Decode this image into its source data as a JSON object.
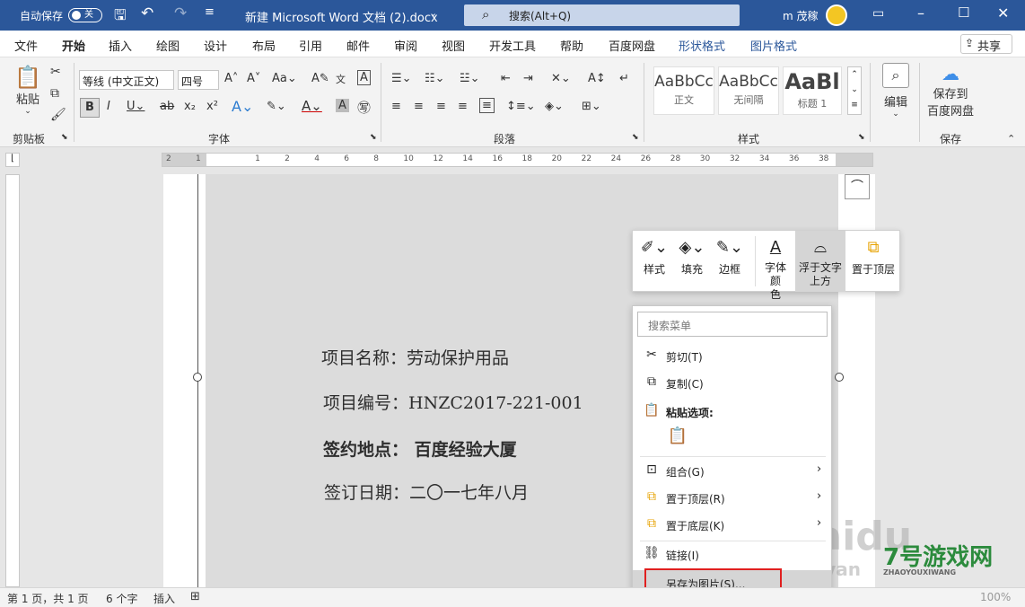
{
  "titlebar": {
    "autosave_label": "自动保存",
    "autosave_state": "关",
    "doc_title": "新建 Microsoft Word 文档 (2).docx",
    "search_placeholder": "搜索(Alt+Q)",
    "user_name": "m 茂稼"
  },
  "tabs": [
    "文件",
    "开始",
    "插入",
    "绘图",
    "设计",
    "布局",
    "引用",
    "邮件",
    "审阅",
    "视图",
    "开发工具",
    "帮助",
    "百度网盘",
    "形状格式",
    "图片格式"
  ],
  "active_tab": "开始",
  "share_label": "共享",
  "ribbon": {
    "clipboard": {
      "paste": "粘贴",
      "group": "剪贴板"
    },
    "font": {
      "name": "等线 (中文正文)",
      "size": "四号",
      "group": "字体"
    },
    "paragraph": {
      "group": "段落"
    },
    "styles": {
      "items": [
        {
          "preview": "AaBbCc",
          "name": "正文"
        },
        {
          "preview": "AaBbCc",
          "name": "无间隔"
        },
        {
          "preview": "AaBl",
          "name": "标题 1"
        }
      ],
      "group": "样式"
    },
    "editing": {
      "label": "编辑"
    },
    "save": {
      "label_line1": "保存到",
      "label_line2": "百度网盘",
      "group": "保存"
    }
  },
  "ruler_ticks": [
    "2",
    "1",
    "",
    "1",
    "2",
    "4",
    "6",
    "8",
    "10",
    "12",
    "14",
    "16",
    "18",
    "20",
    "22",
    "24",
    "26",
    "28",
    "30",
    "32",
    "34",
    "36",
    "38"
  ],
  "document": {
    "lines": [
      "项目名称：劳动保护用品",
      "项目编号：HNZC2017-221-001",
      "签约地点： 百度经验大厦",
      "签订日期：二〇一七年八月"
    ]
  },
  "mini_toolbar": [
    {
      "label": "样式",
      "icon": "style-icon"
    },
    {
      "label": "填充",
      "icon": "fill-icon"
    },
    {
      "label": "边框",
      "icon": "border-icon"
    },
    {
      "label": "字体颜",
      "label2": "色",
      "icon": "font-color-icon"
    },
    {
      "label": "浮于文字",
      "label2": "上方",
      "icon": "float-above-icon"
    },
    {
      "label": "置于顶层",
      "icon": "bring-front-icon"
    }
  ],
  "context_menu": {
    "search_placeholder": "搜索菜单",
    "items": [
      {
        "label": "剪切(T)",
        "icon": "cut-icon"
      },
      {
        "label": "复制(C)",
        "icon": "copy-icon"
      },
      {
        "label": "粘贴选项:",
        "icon": "paste-icon"
      },
      {
        "label": "组合(G)",
        "icon": "group-icon"
      },
      {
        "label": "置于顶层(R)",
        "icon": "bring-front-icon"
      },
      {
        "label": "置于底层(K)",
        "icon": "send-back-icon"
      },
      {
        "label": "链接(I)",
        "icon": "link-icon"
      },
      {
        "label": "另存为图片(S)...",
        "icon": "save-as-picture-icon"
      }
    ]
  },
  "status": {
    "page": "第 1 页，共 1 页",
    "words": "6 个字",
    "mode": "插入",
    "zoom": "100%"
  },
  "watermarks": [
    "Baidu",
    "jingyan",
    "7号游戏网",
    "ZHAOYOUXIWANG"
  ],
  "colors": {
    "accent": "#2b579a",
    "highlight": "#e02020"
  }
}
